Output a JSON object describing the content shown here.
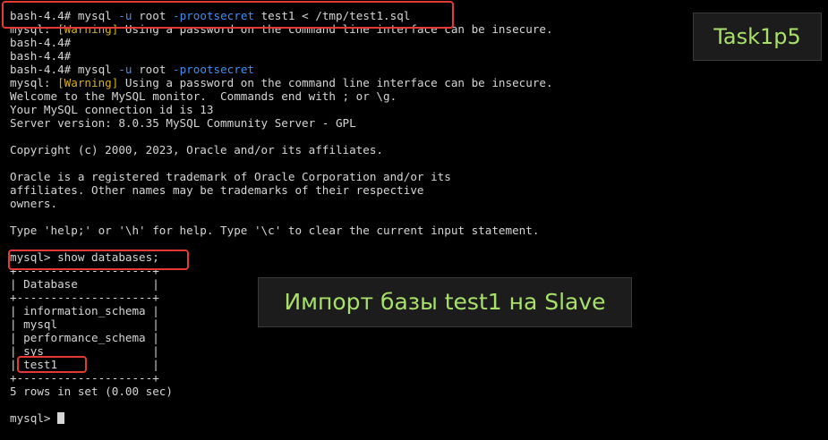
{
  "terminal": {
    "lines": [
      {
        "parts": [
          {
            "t": "bash-4.4# mysql "
          },
          {
            "t": "-u",
            "c": "flag"
          },
          {
            "t": " root "
          },
          {
            "t": "-prootsecret",
            "c": "flag"
          },
          {
            "t": " test1 < /tmp/test1.sql"
          }
        ]
      },
      {
        "parts": [
          {
            "t": "mysql: "
          },
          {
            "t": "[Warning]",
            "c": "warn"
          },
          {
            "t": " Using a password on the command line interface can be insecure."
          }
        ]
      },
      {
        "parts": [
          {
            "t": "bash-4.4#"
          }
        ]
      },
      {
        "parts": [
          {
            "t": "bash-4.4#"
          }
        ]
      },
      {
        "parts": [
          {
            "t": "bash-4.4# mysql "
          },
          {
            "t": "-u",
            "c": "flag"
          },
          {
            "t": " root "
          },
          {
            "t": "-prootsecret",
            "c": "flag"
          }
        ]
      },
      {
        "parts": [
          {
            "t": "mysql: "
          },
          {
            "t": "[Warning]",
            "c": "warn"
          },
          {
            "t": " Using a password on the command line interface can be insecure."
          }
        ]
      },
      {
        "parts": [
          {
            "t": "Welcome to the MySQL monitor.  Commands end with ; or \\g."
          }
        ]
      },
      {
        "parts": [
          {
            "t": "Your MySQL connection id is 13"
          }
        ]
      },
      {
        "parts": [
          {
            "t": "Server version: 8.0.35 MySQL Community Server - GPL"
          }
        ]
      },
      {
        "parts": [
          {
            "t": ""
          }
        ]
      },
      {
        "parts": [
          {
            "t": "Copyright (c) 2000, 2023, Oracle and/or its affiliates."
          }
        ]
      },
      {
        "parts": [
          {
            "t": ""
          }
        ]
      },
      {
        "parts": [
          {
            "t": "Oracle is a registered trademark of Oracle Corporation and/or its"
          }
        ]
      },
      {
        "parts": [
          {
            "t": "affiliates. Other names may be trademarks of their respective"
          }
        ]
      },
      {
        "parts": [
          {
            "t": "owners."
          }
        ]
      },
      {
        "parts": [
          {
            "t": ""
          }
        ]
      },
      {
        "parts": [
          {
            "t": "Type 'help;' or '\\h' for help. Type '\\c' to clear the current input statement."
          }
        ]
      },
      {
        "parts": [
          {
            "t": ""
          }
        ]
      },
      {
        "parts": [
          {
            "t": "mysql> show databases;"
          }
        ]
      },
      {
        "parts": [
          {
            "t": "+--------------------+"
          }
        ]
      },
      {
        "parts": [
          {
            "t": "| Database           |"
          }
        ]
      },
      {
        "parts": [
          {
            "t": "+--------------------+"
          }
        ]
      },
      {
        "parts": [
          {
            "t": "| information_schema |"
          }
        ]
      },
      {
        "parts": [
          {
            "t": "| mysql              |"
          }
        ]
      },
      {
        "parts": [
          {
            "t": "| performance_schema |"
          }
        ]
      },
      {
        "parts": [
          {
            "t": "| sys                |"
          }
        ]
      },
      {
        "parts": [
          {
            "t": "| test1              |"
          }
        ]
      },
      {
        "parts": [
          {
            "t": "+--------------------+"
          }
        ]
      },
      {
        "parts": [
          {
            "t": "5 rows in set (0.00 sec)"
          }
        ]
      },
      {
        "parts": [
          {
            "t": ""
          }
        ]
      },
      {
        "parts": [
          {
            "t": "mysql> "
          }
        ],
        "cursor": true
      }
    ]
  },
  "overlays": {
    "task_badge": "Task1p5",
    "caption": "Импорт базы test1 на Slave"
  },
  "colors": {
    "background": "#000000",
    "text": "#d6d6d6",
    "flag": "#3f8ff0",
    "warning": "#d6b11e",
    "highlight": "#e53935",
    "badge_text": "#a8e06a"
  }
}
